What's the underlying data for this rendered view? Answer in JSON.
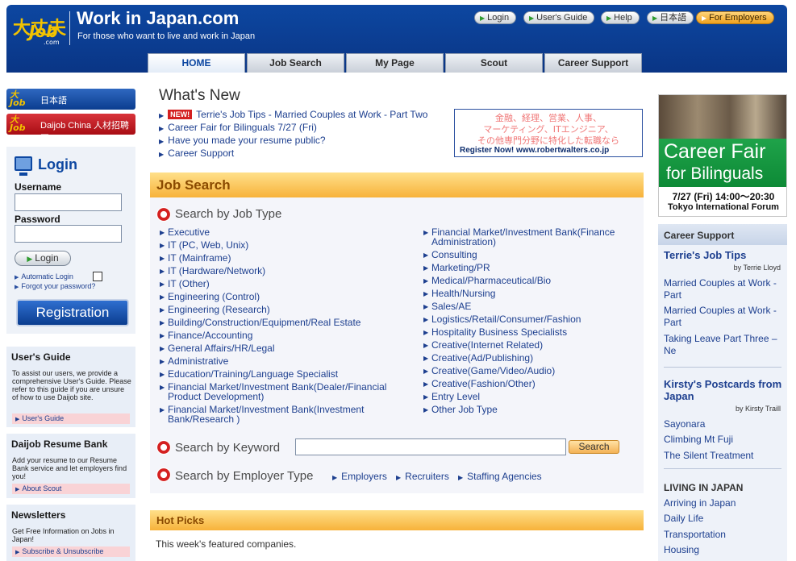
{
  "header": {
    "logo_top": "大丈夫",
    "logo_job": "Job",
    "logo_com": ".com",
    "title": "Work in Japan.com",
    "tagline": "For those who want to live and work in Japan",
    "buttons": [
      {
        "label": "Login"
      },
      {
        "label": "User's Guide"
      },
      {
        "label": "Help"
      },
      {
        "label": "日本語"
      },
      {
        "label": "For Employers"
      }
    ],
    "tabs": [
      {
        "label": "HOME"
      },
      {
        "label": "Job Search"
      },
      {
        "label": "My Page"
      },
      {
        "label": "Scout"
      },
      {
        "label": "Career Support"
      }
    ]
  },
  "left": {
    "lang_jp": "日本語",
    "lang_cn": "Daijob China 人材招聘网",
    "login": {
      "title": "Login",
      "username_label": "Username",
      "password_label": "Password",
      "button": "Login",
      "auto_login": "Automatic Login",
      "forgot": "Forgot your password?",
      "register": "Registration"
    },
    "users_guide": {
      "title": "User's Guide",
      "text": "To assist our users, we provide a comprehensive User's Guide. Please refer to this guide if you are unsure of how to use Daijob site.",
      "link": "User's Guide"
    },
    "resume_bank": {
      "title": "Daijob Resume Bank",
      "text": "Add your resume to our Resume Bank service and let employers find you!",
      "link": "About Scout"
    },
    "newsletters": {
      "title": "Newsletters",
      "text": "Get Free Information on Jobs in Japan!",
      "link": "Subscribe & Unsubscribe"
    }
  },
  "whats_new": {
    "title": "What's New",
    "new_badge": "NEW!",
    "items": [
      {
        "text": "Terrie's Job Tips - Married Couples at Work - Part Two"
      },
      {
        "text": "Career Fair for Bilinguals 7/27 (Fri)"
      },
      {
        "text": "Have you made your resume public?"
      },
      {
        "text": "Career Support"
      }
    ]
  },
  "rw_ad": {
    "line1": "金融、経理、営業、人事、",
    "line2": "マーケティング、ITエンジニア、",
    "line3": "その他専門分野に特化した転職なら",
    "register": "Register Now! www.robertwalters.co.jp"
  },
  "job_search": {
    "title": "Job Search",
    "by_type_title": "Search by Job Type",
    "col1": [
      "Executive",
      "IT (PC, Web, Unix)",
      "IT (Mainframe)",
      "IT (Hardware/Network)",
      "IT (Other)",
      "Engineering (Control)",
      "Engineering (Research)",
      "Building/Construction/Equipment/Real Estate",
      "Finance/Accounting",
      "General Affairs/HR/Legal",
      "Administrative",
      "Education/Training/Language Specialist",
      "Financial Market/Investment Bank(Dealer/Financial Product Development)",
      "Financial Market/Investment Bank(Investment Bank/Research )"
    ],
    "col2": [
      "Financial Market/Investment Bank(Finance Administration)",
      "Consulting",
      "Marketing/PR",
      "Medical/Pharmaceutical/Bio",
      "Health/Nursing",
      "Sales/AE",
      "Logistics/Retail/Consumer/Fashion",
      "Hospitality Business Specialists",
      "Creative(Internet Related)",
      "Creative(Ad/Publishing)",
      "Creative(Game/Video/Audio)",
      "Creative(Fashion/Other)",
      "Entry Level",
      "Other Job Type"
    ],
    "by_keyword_title": "Search by Keyword",
    "keyword_value": "",
    "search_button": "Search",
    "by_employer_title": "Search by Employer Type",
    "employer_links": [
      "Employers",
      "Recruiters",
      "Staffing Agencies"
    ]
  },
  "hot_picks": {
    "title": "Hot Picks",
    "text": "This week's featured companies."
  },
  "career_fair_ad": {
    "line1": "Career Fair",
    "line2": "for Bilinguals",
    "date": "7/27 (Fri) 14:00～20:30",
    "venue": "Tokyo International Forum"
  },
  "career_support": {
    "title": "Career Support",
    "tips_heading": "Terrie's Job Tips",
    "tips_byline": "by Terrie Lloyd",
    "tips_links": [
      "Married Couples at Work - Part",
      "Married Couples at Work - Part",
      "Taking Leave Part Three – Ne"
    ],
    "postcards_heading": "Kirsty's Postcards from Japan",
    "postcards_byline": "by Kirsty Traill",
    "postcards_links": [
      "Sayonara",
      "Climbing Mt Fuji",
      "The Silent Treatment"
    ],
    "living_title": "LIVING IN JAPAN",
    "living_links": [
      "Arriving in Japan",
      "Daily Life",
      "Transportation",
      "Housing"
    ]
  },
  "colors": {
    "brand_blue": "#0d47a1",
    "link_blue": "#1d3f8f",
    "section_orange": "#f7b23a",
    "new_red": "#d42020",
    "fair_green": "#1fa34a"
  }
}
